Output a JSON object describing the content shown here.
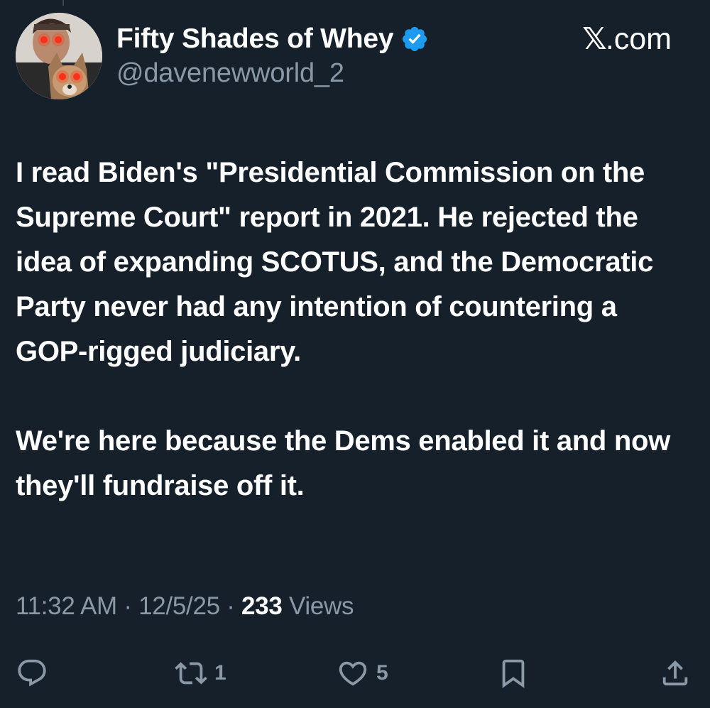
{
  "header": {
    "site_label": ".com",
    "site_glyph": "𝕏"
  },
  "author": {
    "display_name": "Fifty Shades of Whey",
    "handle": "@davenewworld_2",
    "verified_color": "#1d9bf0",
    "avatar_icon": "profile-photo-with-dog"
  },
  "tweet": {
    "paragraphs": [
      "I read Biden's \"Presidential Commission on the Supreme Court\" report in 2021. He rejected the idea of expanding SCOTUS, and the Democratic Party never had any intention of countering a GOP-rigged judiciary.",
      "We're here because the Dems enabled it and now they'll fundraise off it."
    ]
  },
  "meta": {
    "time": "11:32 AM",
    "separator": " · ",
    "date": "12/5/25",
    "views_count": "233",
    "views_label": " Views"
  },
  "actions": {
    "reply_icon": "reply-icon",
    "retweet_icon": "retweet-icon",
    "retweet_count": "1",
    "like_icon": "heart-icon",
    "like_count": "5",
    "bookmark_icon": "bookmark-icon",
    "share_icon": "share-icon"
  },
  "colors": {
    "background": "#15202b",
    "secondary_text": "#8b98a5",
    "primary_text": "#ffffff",
    "accent": "#1d9bf0"
  }
}
